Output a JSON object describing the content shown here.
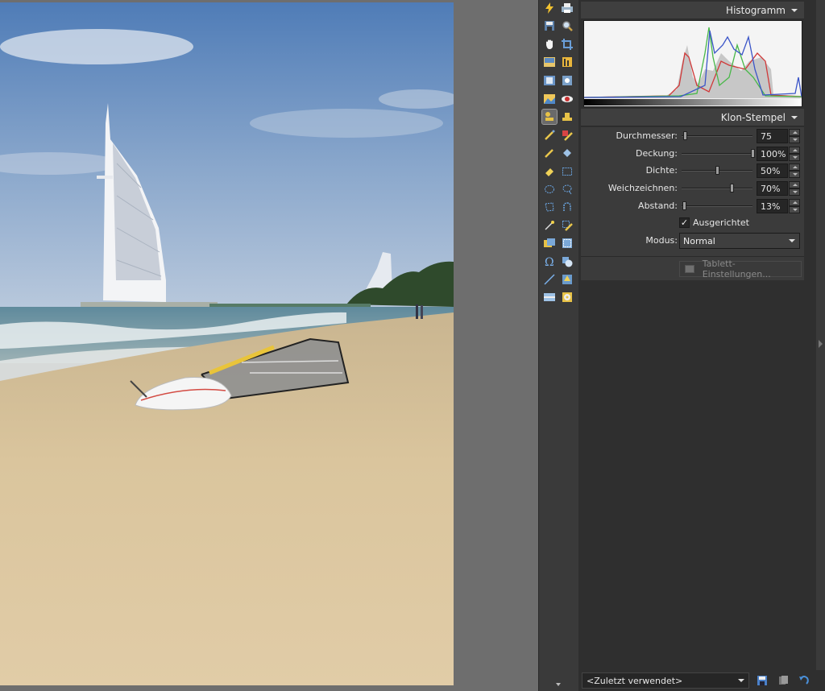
{
  "histogram": {
    "title": "Histogramm"
  },
  "clone_stamp": {
    "title": "Klon-Stempel",
    "params": [
      {
        "label": "Durchmesser:",
        "value": "75",
        "level": 0.05
      },
      {
        "label": "Deckung:",
        "value": "100%",
        "level": 1.0
      },
      {
        "label": "Dichte:",
        "value": "50%",
        "level": 0.5
      },
      {
        "label": "Weichzeichnen:",
        "value": "70%",
        "level": 0.7
      },
      {
        "label": "Abstand:",
        "value": "13%",
        "level": 0.03
      }
    ],
    "aligned_label": "Ausgerichtet",
    "aligned_checked": "✓",
    "mode_label": "Modus:",
    "mode_value": "Normal",
    "tablet_button_label": "Tablett-Einstellungen..."
  },
  "bottom_bar": {
    "recent_value": "<Zuletzt verwendet>"
  },
  "tools": [
    "lightning-icon",
    "print-icon",
    "save-icon",
    "zoom-icon",
    "hand-icon",
    "crop-icon",
    "image-icon",
    "levels-icon",
    "filmstrip-icon",
    "target-icon",
    "landscape-icon",
    "red-eye-icon",
    "clone-stamp-icon",
    "stamp-icon",
    "brush-icon",
    "healing-icon",
    "pen-icon",
    "fill-icon",
    "eraser-icon",
    "rect-select-icon",
    "ellipse-select-icon",
    "lasso-icon",
    "poly-lasso-icon",
    "magnet-lasso-icon",
    "magic-wand-icon",
    "pencil-select-icon",
    "layer-icon",
    "mask-select-icon",
    "text-icon",
    "shape-icon",
    "line-icon",
    "gradient-icon",
    "bars-icon",
    "disc-icon"
  ],
  "colors": {
    "panel": "#2f2f2f",
    "section": "#3b3b3b",
    "canvas": "#6e6e6e",
    "accent": "#4a90d9"
  }
}
